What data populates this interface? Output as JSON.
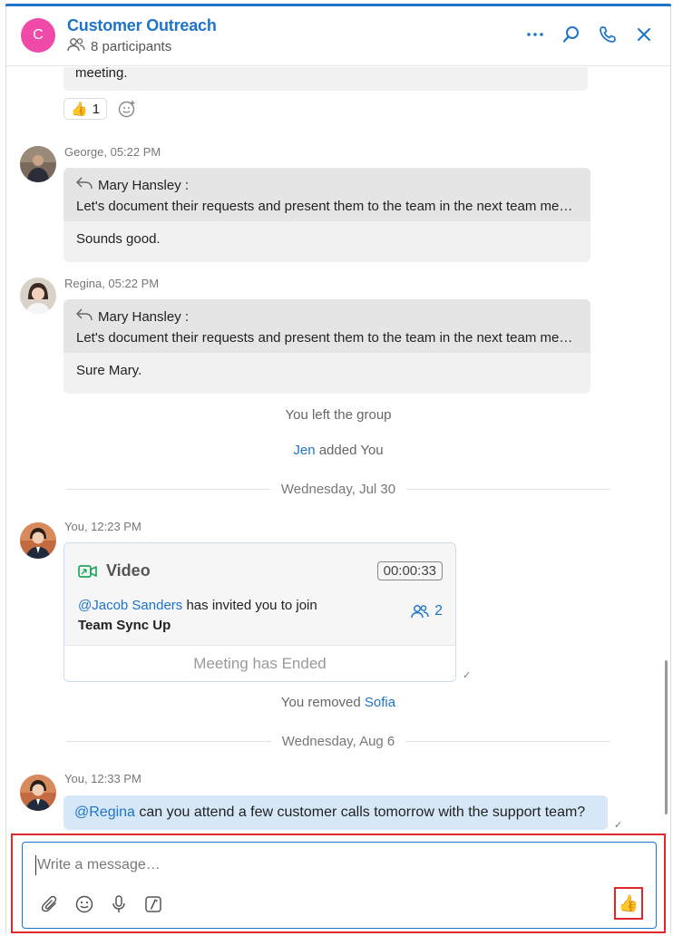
{
  "header": {
    "avatar_letter": "C",
    "title": "Customer Outreach",
    "participants": "8 participants",
    "icons": [
      "more-icon",
      "search-icon",
      "phone-icon",
      "close-icon"
    ]
  },
  "messages": {
    "partial_text": "meeting.",
    "reaction": {
      "emoji": "👍",
      "count": "1"
    },
    "george": {
      "sender": "George, 05:22 PM",
      "quote_name": "Mary  Hansley :",
      "quote_text": "Let's document their requests and present them to the team in the next team meeting.",
      "reply": "Sounds good."
    },
    "regina": {
      "sender": "Regina, 05:22 PM",
      "quote_name": "Mary  Hansley :",
      "quote_text": "Let's document their requests and present them to the team in the next team meeting.",
      "reply": "Sure Mary."
    },
    "left_group": "You left the group",
    "added": {
      "actor": "Jen",
      "rest": " added You"
    },
    "date1": "Wednesday, Jul 30",
    "you1": {
      "sender": "You, 12:23 PM",
      "video": {
        "title": "Video",
        "duration": "00:00:33",
        "mention": "@Jacob Sanders",
        "invite_text": " has invited you to join",
        "meeting": "Team Sync Up",
        "count": "2",
        "ended": "Meeting has Ended"
      }
    },
    "removed": {
      "prefix": "You removed ",
      "name": "Sofia"
    },
    "date2": "Wednesday, Aug 6",
    "you2": {
      "sender": "You, 12:33 PM",
      "mention": "@Regina",
      "text": " can you attend a few customer calls tomorrow with the support team?"
    }
  },
  "composer": {
    "placeholder": "Write a message…",
    "tools": [
      "attach-icon",
      "emoji-icon",
      "mic-icon",
      "format-icon"
    ],
    "send_emoji": "👍"
  },
  "colors": {
    "accent": "#1d74c9",
    "avatar": "#f04aa8",
    "highlight": "#e0282a"
  }
}
